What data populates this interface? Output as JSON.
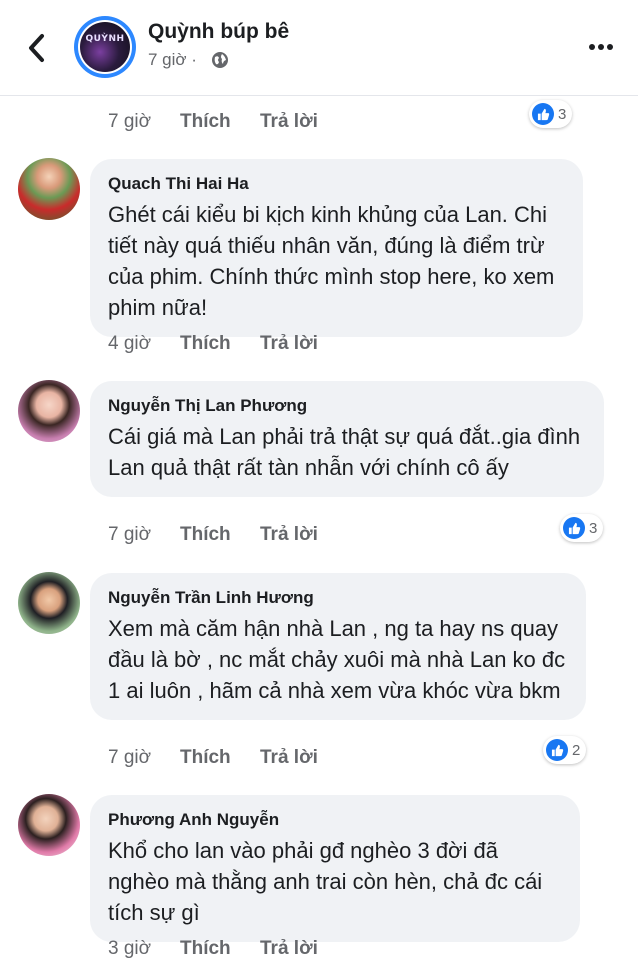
{
  "header": {
    "page_name": "Quỳnh búp bê",
    "time": "7 giờ ·",
    "avatar_text": "QUỲNH"
  },
  "top_comment": {
    "time": "7 giờ",
    "like": "Thích",
    "reply": "Trả lời",
    "reactions": "3"
  },
  "comments": [
    {
      "name": "Quach Thi Hai Ha",
      "text": "Ghét cái kiểu bi kịch kinh khủng của Lan. Chi tiết này quá thiếu nhân văn, đúng là điểm trừ của phim. Chính thức mình stop here, ko xem phim nữa!",
      "time": "4 giờ",
      "like": "Thích",
      "reply": "Trả lời"
    },
    {
      "name": "Nguyễn Thị Lan Phương",
      "text": "Cái giá mà Lan phải trả thật sự quá đắt..gia đình Lan quả thật rất tàn nhẫn với chính cô ấy",
      "time": "7 giờ",
      "like": "Thích",
      "reply": "Trả lời",
      "reactions": "3"
    },
    {
      "name": "Nguyễn Trần Linh Hương",
      "text": "Xem mà căm hận nhà Lan , ng ta hay ns quay đầu là bờ , nc mắt chảy xuôi mà nhà Lan ko đc 1 ai luôn , hãm cả nhà xem vừa khóc vừa bkm",
      "time": "7 giờ",
      "like": "Thích",
      "reply": "Trả lời",
      "reactions": "2"
    },
    {
      "name": "Phương Anh Nguyễn",
      "text": "Khổ cho lan vào phải gđ nghèo 3 đời đã nghèo mà thằng anh trai còn hèn, chả đc cái tích sự gì",
      "time": "3 giờ",
      "like": "Thích",
      "reply": "Trả lời"
    }
  ]
}
